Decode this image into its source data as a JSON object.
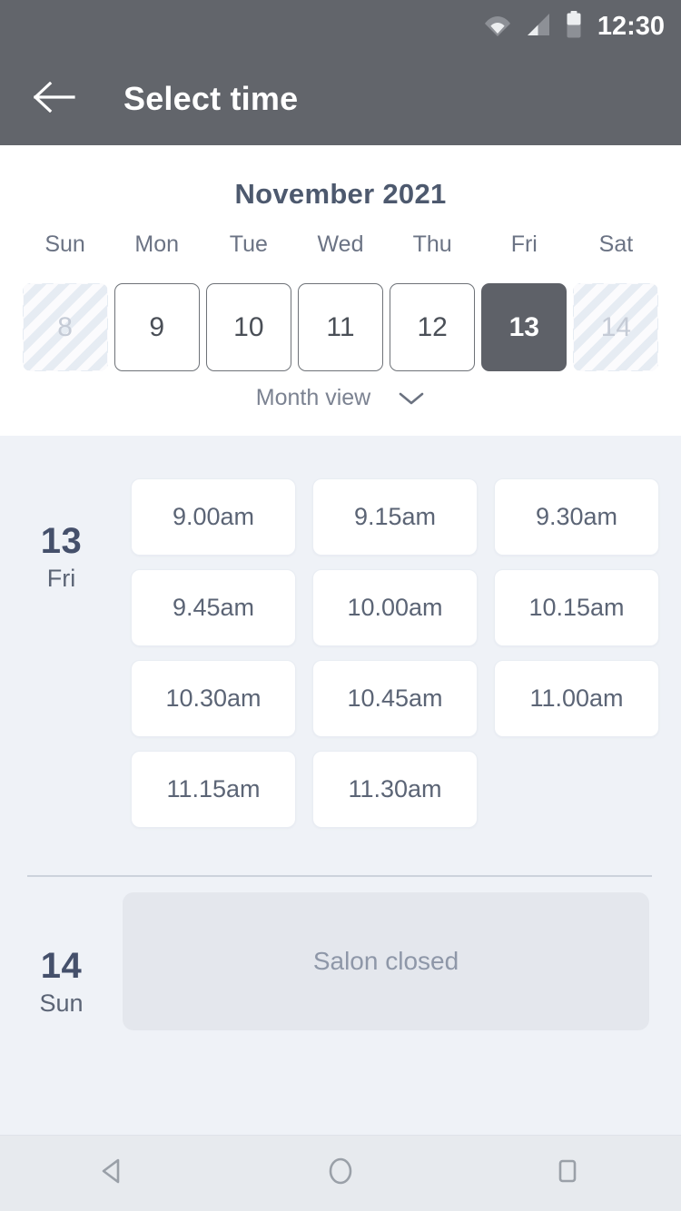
{
  "status_bar": {
    "time": "12:30",
    "icons": [
      "wifi-icon",
      "signal-icon",
      "battery-icon"
    ]
  },
  "app_bar": {
    "back_icon": "arrow-left-icon",
    "title": "Select time"
  },
  "calendar": {
    "month_title": "November 2021",
    "weekdays": [
      "Sun",
      "Mon",
      "Tue",
      "Wed",
      "Thu",
      "Fri",
      "Sat"
    ],
    "days": [
      {
        "number": "8",
        "state": "disabled"
      },
      {
        "number": "9",
        "state": "available"
      },
      {
        "number": "10",
        "state": "available"
      },
      {
        "number": "11",
        "state": "available"
      },
      {
        "number": "12",
        "state": "available"
      },
      {
        "number": "13",
        "state": "selected"
      },
      {
        "number": "14",
        "state": "disabled"
      }
    ],
    "view_toggle": {
      "label": "Month view",
      "icon": "chevron-down-icon"
    }
  },
  "schedule": [
    {
      "date_number": "13",
      "day_of_week": "Fri",
      "status": "open",
      "slots": [
        "9.00am",
        "9.15am",
        "9.30am",
        "9.45am",
        "10.00am",
        "10.15am",
        "10.30am",
        "10.45am",
        "11.00am",
        "11.15am",
        "11.30am"
      ]
    },
    {
      "date_number": "14",
      "day_of_week": "Sun",
      "status": "closed",
      "closed_label": "Salon closed",
      "slots": []
    }
  ],
  "nav_bar": {
    "back_icon": "triangle-back-icon",
    "home_icon": "circle-home-icon",
    "recents_icon": "square-recents-icon"
  },
  "colors": {
    "app_bar_bg": "#62656b",
    "page_bg": "#eff2f7",
    "panel_bg": "#ffffff",
    "selected_day_bg": "#5e6168",
    "text_dark": "#45506b",
    "text_muted": "#8e97a8",
    "closed_box_bg": "#e4e7ed"
  }
}
